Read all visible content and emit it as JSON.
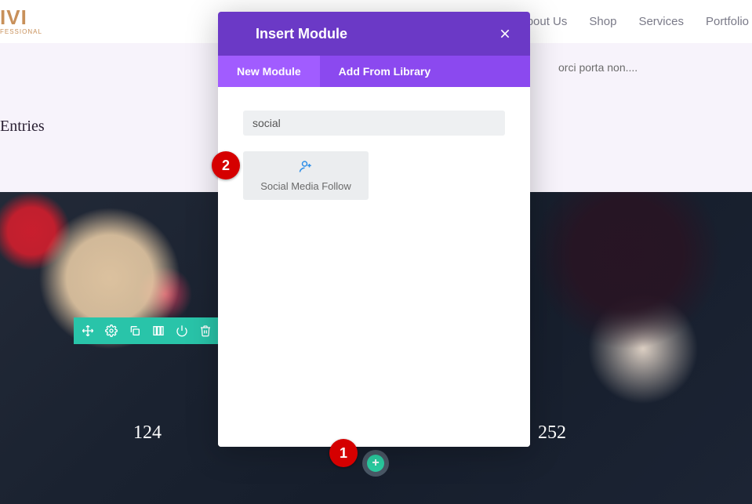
{
  "logo": {
    "text": "IVI",
    "subtext": "FESSIONAL"
  },
  "nav": {
    "about": "About Us",
    "shop": "Shop",
    "services": "Services",
    "portfolio": "Portfolio"
  },
  "page": {
    "entries_label": "Entries",
    "orci_text": "orci porta non....",
    "hero_left": "124",
    "hero_right": "252"
  },
  "toolbar_icons": {
    "move": "move-icon",
    "settings": "gear-icon",
    "duplicate": "duplicate-icon",
    "columns": "columns-icon",
    "power": "power-icon",
    "trash": "trash-icon"
  },
  "add_button": {
    "glyph": "+"
  },
  "modal": {
    "title": "Insert Module",
    "tabs": {
      "new_module": "New Module",
      "add_from_library": "Add From Library"
    },
    "search": {
      "value": "social"
    },
    "module_result": {
      "label": "Social Media Follow"
    }
  },
  "badges": {
    "one": "1",
    "two": "2"
  }
}
